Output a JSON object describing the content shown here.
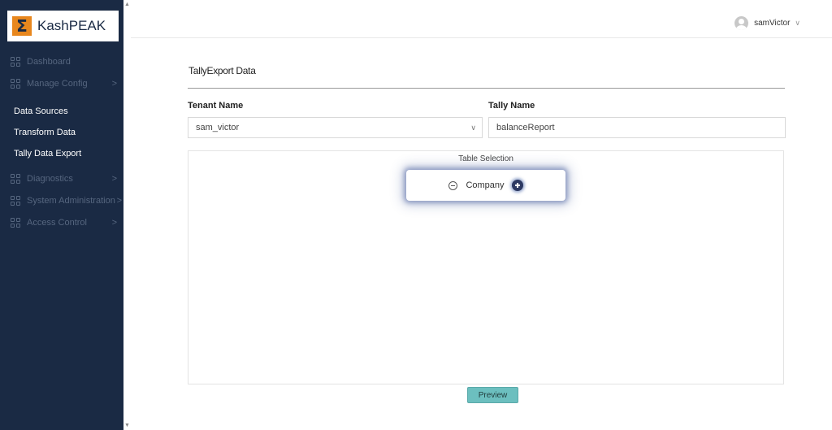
{
  "brand": {
    "name": "KashPEAK",
    "logo_glyph": "Σ",
    "logo_color": "#e8871e"
  },
  "sidebar": {
    "items": [
      {
        "label": "Dashboard",
        "chevron": ""
      },
      {
        "label": "Manage Config",
        "chevron": ">"
      },
      {
        "label": "Data Sources"
      },
      {
        "label": "Transform Data"
      },
      {
        "label": "Tally Data Export"
      },
      {
        "label": "Diagnostics",
        "chevron": ">"
      },
      {
        "label": "System Administration",
        "chevron": ">"
      },
      {
        "label": "Access Control",
        "chevron": ">"
      }
    ],
    "background": "#1a2a44"
  },
  "header": {
    "user_name": "samVictor",
    "user_chevron": "∨"
  },
  "page": {
    "title": "TallyExport Data",
    "tenant_label": "Tenant Name",
    "tenant_value": "sam_victor",
    "select_arrow": "∨",
    "tally_label": "Tally Name",
    "tally_value": "balanceReport",
    "panel_title": "Table Selection",
    "node_label": "Company",
    "preview_label": "Preview"
  },
  "colors": {
    "accent_button": "#6cbfbf",
    "node_glow": "#3c5596"
  }
}
